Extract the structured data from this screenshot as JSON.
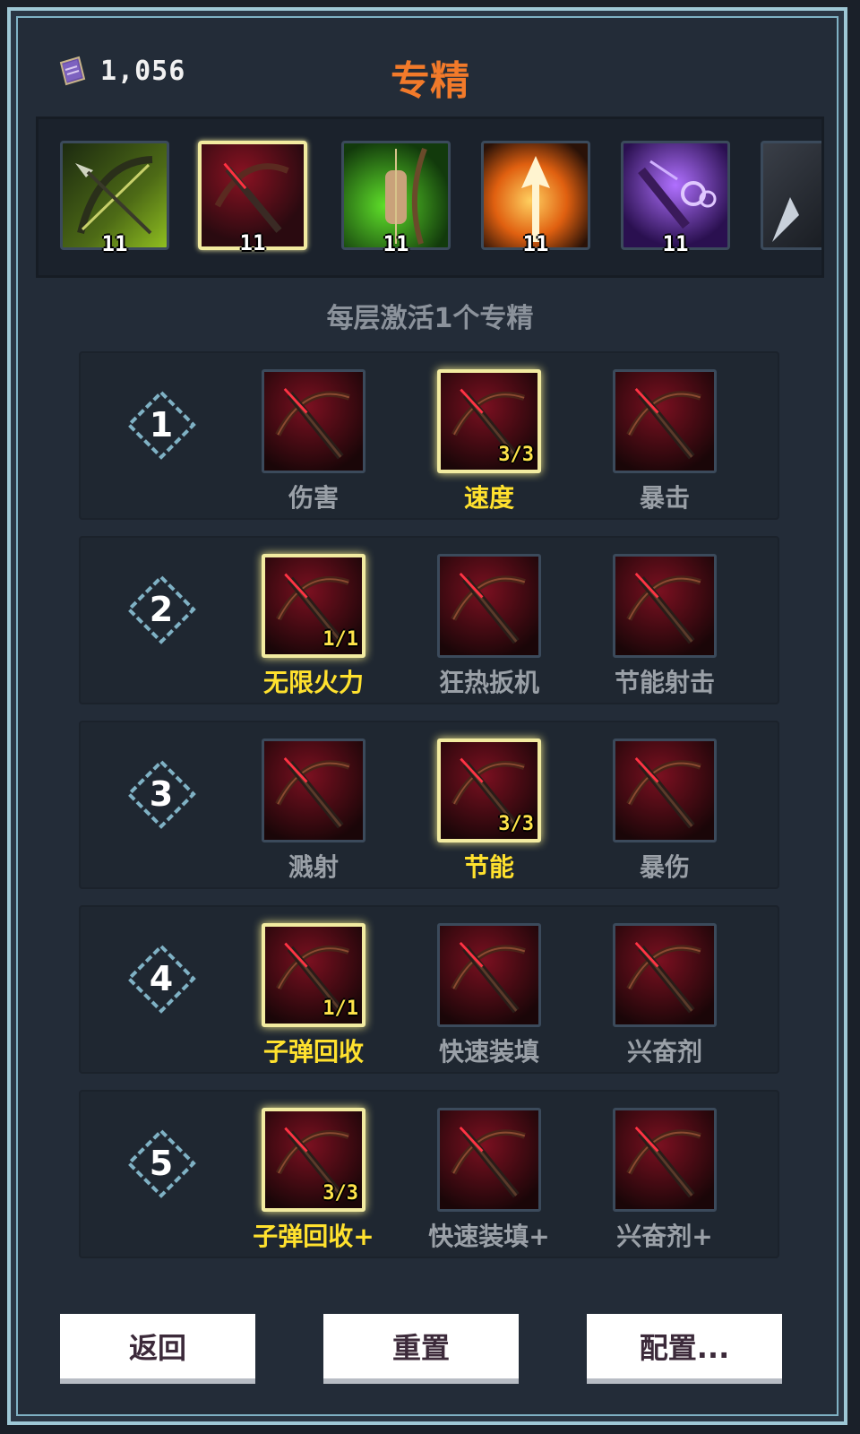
{
  "header": {
    "currency_icon": "spellbook-icon",
    "currency_value": "1,056",
    "title": "专精"
  },
  "weapons": [
    {
      "name": "green-bow-icon",
      "level": "11",
      "selected": false,
      "color": "#9acd32"
    },
    {
      "name": "crossbow-icon",
      "level": "11",
      "selected": true,
      "color": "#b3122a"
    },
    {
      "name": "longbow-icon",
      "level": "11",
      "selected": false,
      "color": "#3fae3a"
    },
    {
      "name": "flame-arrow-icon",
      "level": "11",
      "selected": false,
      "color": "#f39020"
    },
    {
      "name": "arcane-crossbow-icon",
      "level": "11",
      "selected": false,
      "color": "#7a3bd6"
    },
    {
      "name": "silver-arrow-icon",
      "level": "",
      "selected": false,
      "color": "#aab2bd"
    }
  ],
  "hint": "每层激活1个专精",
  "tiers": [
    {
      "number": "1",
      "skills": [
        {
          "label": "伤害",
          "rank": "",
          "active": false
        },
        {
          "label": "速度",
          "rank": "3/3",
          "active": true
        },
        {
          "label": "暴击",
          "rank": "",
          "active": false
        }
      ]
    },
    {
      "number": "2",
      "skills": [
        {
          "label": "无限火力",
          "rank": "1/1",
          "active": true
        },
        {
          "label": "狂热扳机",
          "rank": "",
          "active": false
        },
        {
          "label": "节能射击",
          "rank": "",
          "active": false
        }
      ]
    },
    {
      "number": "3",
      "skills": [
        {
          "label": "溅射",
          "rank": "",
          "active": false
        },
        {
          "label": "节能",
          "rank": "3/3",
          "active": true
        },
        {
          "label": "暴伤",
          "rank": "",
          "active": false
        }
      ]
    },
    {
      "number": "4",
      "skills": [
        {
          "label": "子弹回收",
          "rank": "1/1",
          "active": true
        },
        {
          "label": "快速装填",
          "rank": "",
          "active": false
        },
        {
          "label": "兴奋剂",
          "rank": "",
          "active": false
        }
      ]
    },
    {
      "number": "5",
      "skills": [
        {
          "label": "子弹回收+",
          "rank": "3/3",
          "active": true
        },
        {
          "label": "快速装填+",
          "rank": "",
          "active": false
        },
        {
          "label": "兴奋剂+",
          "rank": "",
          "active": false
        }
      ]
    }
  ],
  "buttons": {
    "back": "返回",
    "reset": "重置",
    "config": "配置..."
  },
  "colors": {
    "accent_title": "#f27a2a",
    "active_text": "#ffe12e",
    "inactive_text": "#9aa0a7",
    "frame": "#9ec8d6"
  }
}
